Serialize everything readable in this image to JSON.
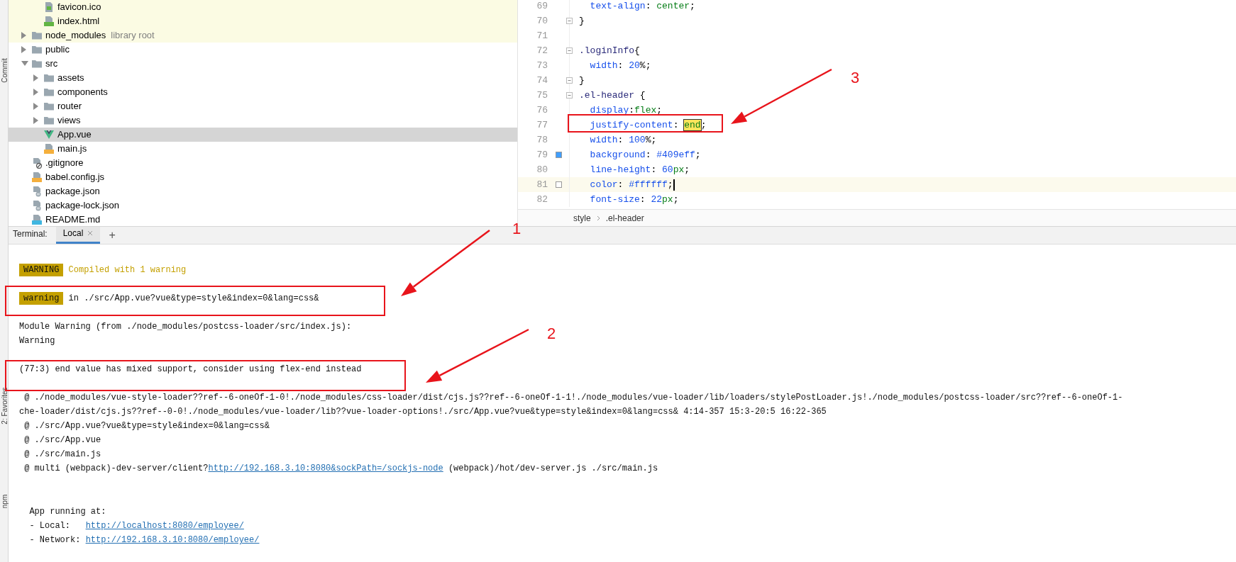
{
  "tool_strip": [
    {
      "label": "Commit"
    },
    {
      "label": "2: Favorites"
    },
    {
      "label": "npm"
    }
  ],
  "project_tree": {
    "partial_children": [
      {
        "label": "favicon.ico",
        "kind": "image",
        "highlighted": true
      },
      {
        "label": "index.html",
        "kind": "html",
        "highlighted": true
      }
    ],
    "items": [
      {
        "label": "node_modules",
        "note": "library root",
        "kind": "folder",
        "expanded": false,
        "highlighted": true,
        "selected": false
      },
      {
        "label": "public",
        "kind": "folder",
        "expanded": false,
        "highlighted": false,
        "selected": false
      },
      {
        "label": "src",
        "kind": "folder",
        "expanded": true,
        "highlighted": false,
        "selected": false,
        "children": [
          {
            "label": "assets",
            "kind": "folder",
            "expanded": false,
            "highlighted": false,
            "selected": false
          },
          {
            "label": "components",
            "kind": "folder",
            "expanded": false,
            "highlighted": false,
            "selected": false
          },
          {
            "label": "router",
            "kind": "folder",
            "expanded": false,
            "highlighted": false,
            "selected": false
          },
          {
            "label": "views",
            "kind": "folder",
            "expanded": false,
            "highlighted": false,
            "selected": false
          },
          {
            "label": "App.vue",
            "kind": "vue",
            "highlighted": false,
            "selected": true
          },
          {
            "label": "main.js",
            "kind": "js",
            "highlighted": false,
            "selected": false
          }
        ]
      },
      {
        "label": ".gitignore",
        "kind": "ignore",
        "highlighted": false,
        "selected": false
      },
      {
        "label": "babel.config.js",
        "kind": "js",
        "highlighted": false,
        "selected": false
      },
      {
        "label": "package.json",
        "kind": "json",
        "highlighted": false,
        "selected": false
      },
      {
        "label": "package-lock.json",
        "kind": "json",
        "highlighted": false,
        "selected": false
      },
      {
        "label": "README.md",
        "kind": "md",
        "highlighted": false,
        "selected": false
      }
    ]
  },
  "editor": {
    "lines": [
      {
        "number": "69",
        "tokens": [
          {
            "kind": "prop",
            "text": "  text-align"
          },
          {
            "kind": "punct",
            "text": ": "
          },
          {
            "kind": "value",
            "text": "center"
          },
          {
            "kind": "punct",
            "text": ";"
          }
        ]
      },
      {
        "number": "70",
        "fold": true,
        "tokens": [
          {
            "kind": "punct",
            "text": "}"
          }
        ]
      },
      {
        "number": "71"
      },
      {
        "number": "72",
        "fold": true,
        "tokens": [
          {
            "kind": "selector",
            "text": ".loginInfo"
          },
          {
            "kind": "punct",
            "text": "{"
          }
        ]
      },
      {
        "number": "73",
        "tokens": [
          {
            "kind": "prop",
            "text": "  width"
          },
          {
            "kind": "punct",
            "text": ": "
          },
          {
            "kind": "number",
            "text": "20"
          },
          {
            "kind": "punct",
            "text": "%;"
          }
        ]
      },
      {
        "number": "74",
        "fold": true,
        "tokens": [
          {
            "kind": "punct",
            "text": "}"
          }
        ]
      },
      {
        "number": "75",
        "fold": true,
        "tokens": [
          {
            "kind": "selector",
            "text": ".el-header"
          },
          {
            "kind": "punct",
            "text": " {"
          }
        ]
      },
      {
        "number": "76",
        "tokens": [
          {
            "kind": "prop",
            "text": "  display"
          },
          {
            "kind": "punct",
            "text": ":"
          },
          {
            "kind": "value",
            "text": "flex"
          },
          {
            "kind": "punct",
            "text": ";"
          }
        ]
      },
      {
        "number": "77",
        "tokens": [
          {
            "kind": "prop",
            "text": "  justify-content"
          },
          {
            "kind": "punct",
            "text": ": "
          },
          {
            "kind": "match",
            "text": "end"
          },
          {
            "kind": "punct",
            "text": ";"
          }
        ]
      },
      {
        "number": "78",
        "tokens": [
          {
            "kind": "prop",
            "text": "  width"
          },
          {
            "kind": "punct",
            "text": ": "
          },
          {
            "kind": "number",
            "text": "100"
          },
          {
            "kind": "punct",
            "text": "%;"
          }
        ]
      },
      {
        "number": "79",
        "swatch": true,
        "tokens": [
          {
            "kind": "prop",
            "text": "  background"
          },
          {
            "kind": "punct",
            "text": ": "
          },
          {
            "kind": "number",
            "text": "#409eff"
          },
          {
            "kind": "punct",
            "text": ";"
          }
        ]
      },
      {
        "number": "80",
        "tokens": [
          {
            "kind": "prop",
            "text": "  line-height"
          },
          {
            "kind": "punct",
            "text": ": "
          },
          {
            "kind": "number",
            "text": "60"
          },
          {
            "kind": "value",
            "text": "px"
          },
          {
            "kind": "punct",
            "text": ";"
          }
        ]
      },
      {
        "number": "81",
        "current": true,
        "swatch": true,
        "tokens": [
          {
            "kind": "prop",
            "text": "  color"
          },
          {
            "kind": "punct",
            "text": ": "
          },
          {
            "kind": "number",
            "text": "#ffffff"
          },
          {
            "kind": "punct",
            "text": ";"
          }
        ]
      },
      {
        "number": "82",
        "tokens": [
          {
            "kind": "prop",
            "text": "  font-size"
          },
          {
            "kind": "punct",
            "text": ": "
          },
          {
            "kind": "number",
            "text": "22"
          },
          {
            "kind": "value",
            "text": "px"
          },
          {
            "kind": "punct",
            "text": ";"
          }
        ]
      }
    ],
    "breadcrumb": [
      "style",
      ".el-header"
    ]
  },
  "terminal": {
    "label": "Terminal:",
    "tabs": [
      {
        "label": "Local",
        "selected": true
      }
    ],
    "add_tab": "+",
    "blocks": [
      [
        {
          "badge": "WARNING",
          "segments": [
            {
              "kind": "warn",
              "text": " Compiled with 1 warning"
            }
          ]
        }
      ],
      [
        {
          "badge": "warning",
          "segments": [
            {
              "kind": "plain",
              "text": " in ./src/App.vue?vue&type=style&index=0&lang=css&"
            }
          ]
        }
      ],
      [
        {
          "segments": [
            {
              "kind": "plain",
              "text": "Module Warning (from ./node_modules/postcss-loader/src/index.js):"
            }
          ]
        },
        {
          "segments": [
            {
              "kind": "plain",
              "text": "Warning"
            }
          ]
        }
      ],
      [
        {
          "segments": [
            {
              "kind": "plain",
              "text": "(77:3) end value has mixed support, consider using flex-end instead"
            }
          ]
        }
      ],
      [
        {
          "segments": [
            {
              "kind": "plain",
              "text": " @ ./node_modules/vue-style-loader??ref--6-oneOf-1-0!./node_modules/css-loader/dist/cjs.js??ref--6-oneOf-1-1!./node_modules/vue-loader/lib/loaders/stylePostLoader.js!./node_modules/postcss-loader/src??ref--6-oneOf-1-"
            }
          ]
        },
        {
          "segments": [
            {
              "kind": "plain",
              "text": "che-loader/dist/cjs.js??ref--0-0!./node_modules/vue-loader/lib??vue-loader-options!./src/App.vue?vue&type=style&index=0&lang=css& 4:14-357 15:3-20:5 16:22-365"
            }
          ]
        },
        {
          "segments": [
            {
              "kind": "plain",
              "text": " @ ./src/App.vue?vue&type=style&index=0&lang=css&"
            }
          ]
        },
        {
          "segments": [
            {
              "kind": "plain",
              "text": " @ ./src/App.vue"
            }
          ]
        },
        {
          "segments": [
            {
              "kind": "plain",
              "text": " @ ./src/main.js"
            }
          ]
        },
        {
          "segments": [
            {
              "kind": "plain",
              "text": " @ multi (webpack)-dev-server/client?"
            },
            {
              "kind": "link",
              "text": "http://192.168.3.10:8080&sockPath=/sockjs-node"
            },
            {
              "kind": "plain",
              "text": " (webpack)/hot/dev-server.js ./src/main.js"
            }
          ]
        }
      ],
      [
        {
          "segments": [
            {
              "kind": "plain",
              "text": "  App running at:"
            }
          ]
        },
        {
          "segments": [
            {
              "kind": "plain",
              "text": "  - Local:   "
            },
            {
              "kind": "link",
              "text": "http://localhost:8080/employee/"
            }
          ]
        },
        {
          "segments": [
            {
              "kind": "plain",
              "text": "  - Network: "
            },
            {
              "kind": "link",
              "text": "http://192.168.3.10:8080/employee/"
            }
          ]
        }
      ]
    ]
  },
  "annotations": [
    {
      "label": "1"
    },
    {
      "label": "2"
    },
    {
      "label": "3"
    }
  ]
}
